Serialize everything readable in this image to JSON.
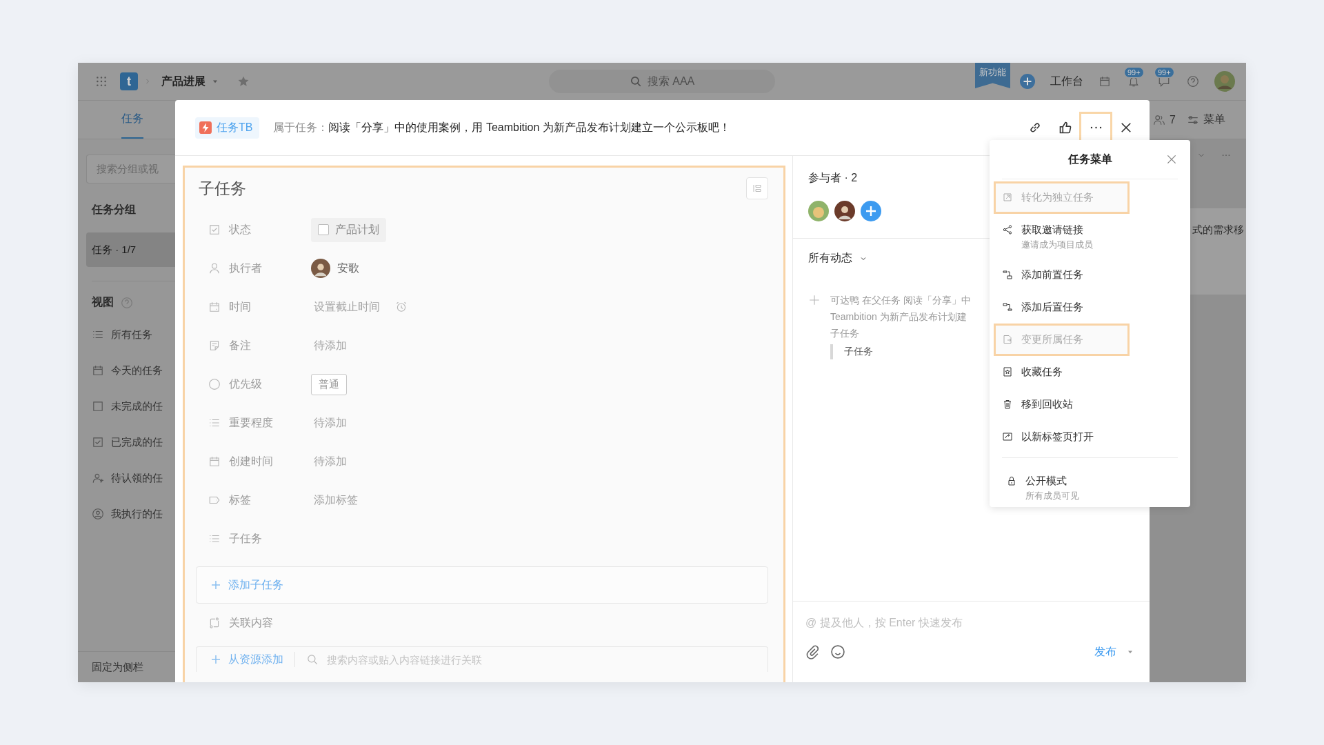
{
  "app": {
    "top_bar": {
      "logo": "t",
      "project": "产品进展",
      "search_placeholder": "搜索 AAA",
      "new_feature_badge": "新功能",
      "workbench": "工作台",
      "badges": [
        "99+",
        "99+"
      ]
    },
    "tabs": [
      {
        "label": "任务",
        "selected": true
      }
    ],
    "tab_bar_right": {
      "member_count": "7",
      "menu": "菜单"
    },
    "sidebar": {
      "search_placeholder": "搜索分组或视",
      "group_title": "任务分组",
      "groups": [
        {
          "label": "任务 · 1/7",
          "selected": true
        }
      ],
      "views_title": "视图",
      "views": [
        {
          "kind": "list",
          "label": "所有任务"
        },
        {
          "kind": "calendar",
          "label": "今天的任务"
        },
        {
          "kind": "unchecked",
          "label": "未完成的任"
        },
        {
          "kind": "checked",
          "label": "已完成的任"
        },
        {
          "kind": "person-add",
          "label": "待认领的任"
        },
        {
          "kind": "person-circle",
          "label": "我执行的任"
        }
      ],
      "pin": "固定为侧栏"
    },
    "board_text": "式的需求移"
  },
  "task_dialog": {
    "tag": "任务TB",
    "parent_prefix": "属于任务：",
    "parent_title": "阅读「分享」中的使用案例，用 Teambition 为新产品发布计划建立一个公示板吧！",
    "more_highlighted": true,
    "detail": {
      "highlighted": true,
      "title": "子任务",
      "fields": [
        {
          "kind": "status",
          "label": "状态",
          "value": "产品计划",
          "checked": false
        },
        {
          "kind": "assignee",
          "label": "执行者",
          "value": "安歌"
        },
        {
          "kind": "time",
          "label": "时间",
          "placeholder": "设置截止时间"
        },
        {
          "kind": "note",
          "label": "备注",
          "placeholder": "待添加"
        },
        {
          "kind": "priority",
          "label": "优先级",
          "value": "普通"
        },
        {
          "kind": "importance",
          "label": "重要程度",
          "placeholder": "待添加"
        },
        {
          "kind": "created",
          "label": "创建时间",
          "placeholder": "待添加"
        },
        {
          "kind": "tags",
          "label": "标签",
          "placeholder": "添加标签"
        },
        {
          "kind": "subtasks",
          "label": "子任务"
        }
      ],
      "add_subtask": "添加子任务",
      "links_label": "关联内容",
      "add_from_resource": "从资源添加",
      "link_search_placeholder": "搜索内容或贴入内容链接进行关联"
    },
    "activity": {
      "participants_title": "参与者 · 2",
      "filter": "所有动态",
      "entries": [
        {
          "lines": [
            "可达鸭 在父任务 阅读「分享」中",
            "Teambition 为新产品发布计划建",
            "子任务"
          ],
          "quote": "子任务"
        }
      ],
      "comment_placeholder": "@ 提及他人，按 Enter 快速发布",
      "publish": "发布"
    }
  },
  "menu": {
    "title": "任务菜单",
    "groups": [
      [
        {
          "kind": "convert",
          "label": "转化为独立任务",
          "disabled": true,
          "highlighted": true
        },
        {
          "kind": "share",
          "label": "获取邀请链接",
          "sub": "邀请成为项目成员",
          "disabled": false,
          "highlighted": false
        },
        {
          "kind": "predecessor",
          "label": "添加前置任务",
          "disabled": false,
          "highlighted": false
        },
        {
          "kind": "successor",
          "label": "添加后置任务",
          "disabled": false,
          "highlighted": false
        },
        {
          "kind": "change-parent",
          "label": "变更所属任务",
          "disabled": true,
          "highlighted": true
        },
        {
          "kind": "favorite",
          "label": "收藏任务",
          "disabled": false,
          "highlighted": false
        },
        {
          "kind": "trash",
          "label": "移到回收站",
          "disabled": false,
          "highlighted": false
        },
        {
          "kind": "open-tab",
          "label": "以新标签页打开",
          "disabled": false,
          "highlighted": false
        }
      ],
      [
        {
          "kind": "lock",
          "label": "公开模式",
          "sub": "所有成员可见",
          "disabled": false,
          "highlighted": false
        }
      ]
    ]
  }
}
